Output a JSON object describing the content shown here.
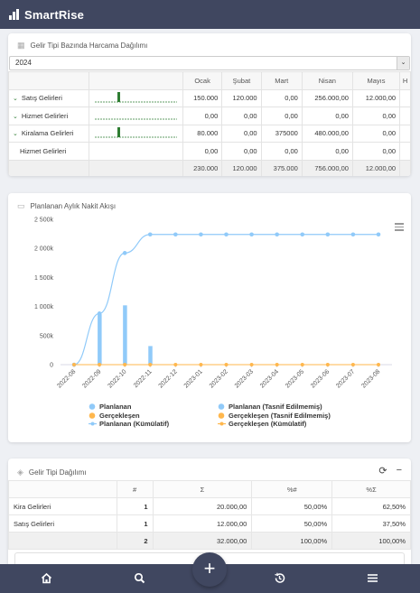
{
  "app": {
    "name": "SmartRise"
  },
  "spending": {
    "title": "Gelir Tipi Bazında Harcama Dağılımı",
    "year": "2024",
    "months": [
      "Ocak",
      "Şubat",
      "Mart",
      "Nisan",
      "Mayıs",
      "H"
    ],
    "rows": [
      {
        "label": "Satış Gelirleri",
        "expanded": true,
        "values": [
          "150.000",
          "120.000",
          "0,00",
          "256.000,00",
          "12.000,00"
        ]
      },
      {
        "label": "Hizmet Gelirleri",
        "expanded": true,
        "values": [
          "0,00",
          "0,00",
          "0,00",
          "0,00",
          "0,00"
        ]
      },
      {
        "label": "Kiralama Gelirleri",
        "expanded": true,
        "values": [
          "80.000",
          "0,00",
          "375000",
          "480.000,00",
          "0,00"
        ]
      },
      {
        "label": "Hizmet Gelirleri",
        "expanded": false,
        "values": [
          "0,00",
          "0,00",
          "0,00",
          "0,00",
          "0,00"
        ]
      }
    ],
    "totals": [
      "230.000",
      "120.000",
      "375.000",
      "756.000,00",
      "12.000,00"
    ]
  },
  "cashflow": {
    "title": "Planlanan Aylık Nakit Akışı"
  },
  "chart_data": {
    "type": "line",
    "x": [
      "2022-08",
      "2022-09",
      "2022-10",
      "2022-11",
      "2022-12",
      "2023-01",
      "2023-02",
      "2023-03",
      "2023-04",
      "2023-05",
      "2023-06",
      "2023-07",
      "2023-08"
    ],
    "y_ticks": [
      "0",
      "500k",
      "1 000k",
      "1 500k",
      "2 000k",
      "2 500k"
    ],
    "ylim": [
      0,
      2500000
    ],
    "bars": [
      {
        "x": "2022-09",
        "value": 870000
      },
      {
        "x": "2022-10",
        "value": 1020000
      },
      {
        "x": "2022-11",
        "value": 320000
      }
    ],
    "series": [
      {
        "name": "Planlanan (Kümülatif)",
        "values": [
          0,
          880000,
          1920000,
          2240000,
          2240000,
          2240000,
          2240000,
          2240000,
          2240000,
          2240000,
          2240000,
          2240000,
          2240000
        ]
      },
      {
        "name": "Gerçekleşen (Kümülatif)",
        "values": [
          0,
          0,
          0,
          0,
          0,
          0,
          0,
          0,
          0,
          0,
          0,
          0,
          0
        ]
      }
    ],
    "legend": [
      {
        "label": "Planlanan",
        "color": "#90caf9",
        "marker": "circle"
      },
      {
        "label": "Planlanan (Tasnif Edilmemiş)",
        "color": "#90caf9",
        "marker": "circle"
      },
      {
        "label": "Gerçekleşen",
        "color": "#ffb74d",
        "marker": "circle"
      },
      {
        "label": "Gerçekleşen (Tasnif Edilmemiş)",
        "color": "#ffb74d",
        "marker": "circle"
      },
      {
        "label": "Planlanan (Kümülatif)",
        "color": "#90caf9",
        "marker": "line"
      },
      {
        "label": "Gerçekleşen (Kümülatif)",
        "color": "#ffb74d",
        "marker": "line"
      }
    ],
    "legend_position": "bottom"
  },
  "distribution": {
    "title": "Gelir Tipi Dağılımı",
    "headers": [
      "",
      "#",
      "Σ",
      "%#",
      "%Σ"
    ],
    "rows": [
      {
        "label": "Kira Gelirleri",
        "count": "1",
        "sum": "20.000,00",
        "pct_count": "50,00%",
        "pct_sum": "62,50%"
      },
      {
        "label": "Satış Gelirleri",
        "count": "1",
        "sum": "12.000,00",
        "pct_count": "50,00%",
        "pct_sum": "37,50%"
      }
    ],
    "total": {
      "count": "2",
      "sum": "32.000,00",
      "pct_count": "100,00%",
      "pct_sum": "100,00%"
    }
  },
  "nav": {
    "items": [
      "home-icon",
      "search-icon",
      "add-icon",
      "history-icon",
      "menu-icon"
    ],
    "fab_label": "+"
  },
  "colors": {
    "primary": "#404760",
    "planned": "#90caf9",
    "actual": "#ffb74d",
    "spark": "#2e7d32"
  }
}
